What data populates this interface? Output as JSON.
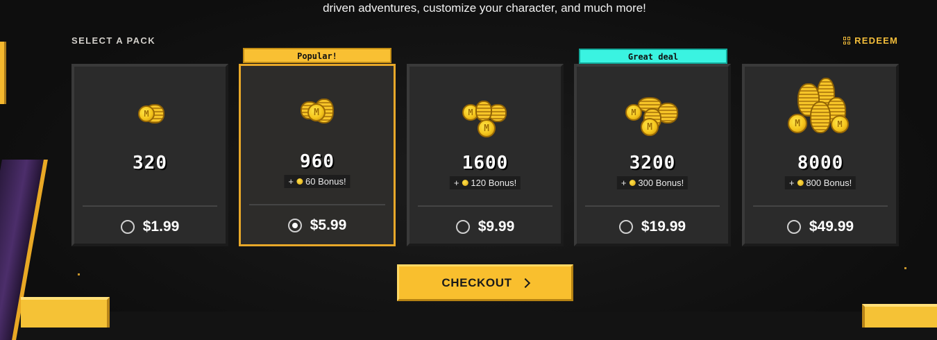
{
  "intro": {
    "text": "driven adventures, customize your character, and much more!"
  },
  "header": {
    "select_label": "SELECT A PACK",
    "redeem_label": "REDEEM",
    "redeem_icon": "grid-icon"
  },
  "packs": [
    {
      "badge": "",
      "amount": "320",
      "bonus": "",
      "price": "$1.99",
      "selected": false
    },
    {
      "badge": "Popular!",
      "badge_color": "#f9c033",
      "amount": "960",
      "bonus_prefix": "+",
      "bonus": "60 Bonus!",
      "price": "$5.99",
      "selected": true
    },
    {
      "badge": "",
      "amount": "1600",
      "bonus_prefix": "+",
      "bonus": "120 Bonus!",
      "price": "$9.99",
      "selected": false
    },
    {
      "badge": "Great deal",
      "badge_color": "#3af3e1",
      "amount": "3200",
      "bonus_prefix": "+",
      "bonus": "300 Bonus!",
      "price": "$19.99",
      "selected": false
    },
    {
      "badge": "",
      "amount": "8000",
      "bonus_prefix": "+",
      "bonus": "800 Bonus!",
      "price": "$49.99",
      "selected": false
    }
  ],
  "checkout": {
    "label": "CHECKOUT"
  },
  "colors": {
    "accent": "#f9bf2e",
    "selected_border": "#e8a829",
    "great_deal": "#3af3e1"
  }
}
